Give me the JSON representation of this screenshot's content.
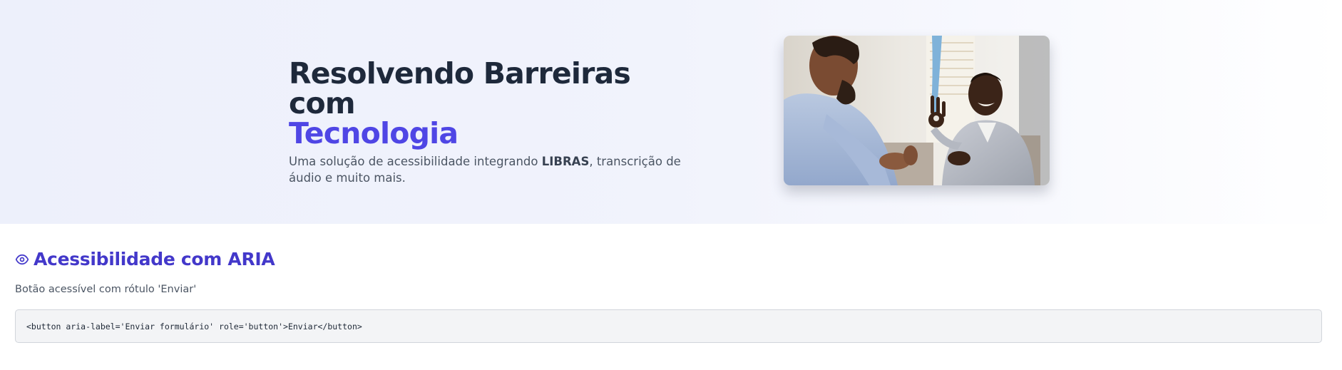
{
  "hero": {
    "title_line1": "Resolvendo Barreiras com",
    "title_accent": "Tecnologia",
    "subtitle_before": "Uma solução de acessibilidade integrando ",
    "subtitle_bold": "LIBRAS",
    "subtitle_after": ", transcrição de áudio e muito mais.",
    "image": {
      "icon": "photo-two-men-sign-language",
      "alt": ""
    }
  },
  "section": {
    "icon": "eye-icon",
    "title": "Acessibilidade com ARIA",
    "description": "Botão acessível com rótulo 'Enviar'",
    "code": "<button aria-label='Enviar formulário' role='button'>Enviar</button>"
  },
  "colors": {
    "accent": "#4f46e5",
    "section_title": "#4338ca",
    "heading": "#1e293b",
    "body_text": "#4b5563",
    "code_bg": "#f3f4f6"
  }
}
